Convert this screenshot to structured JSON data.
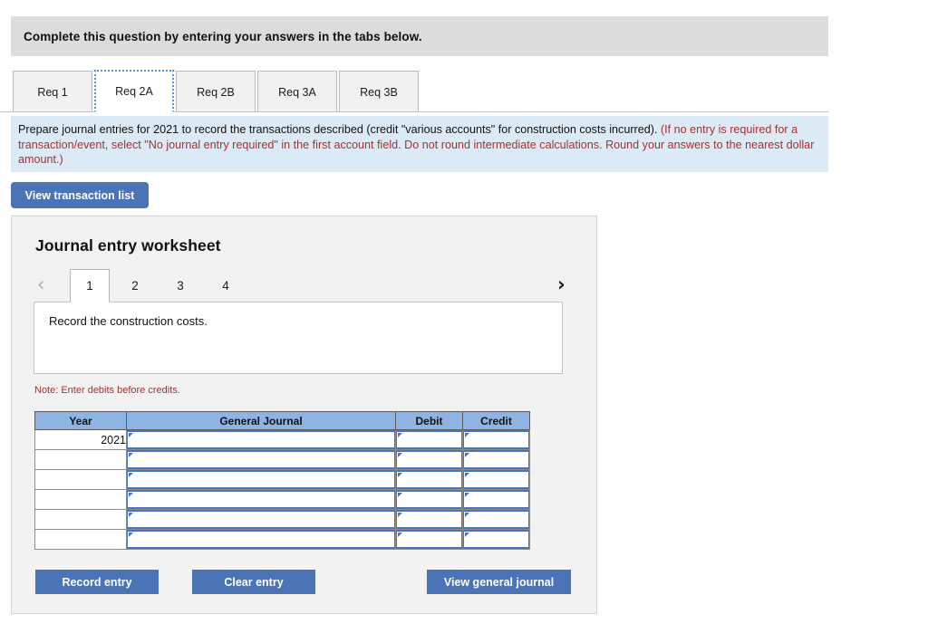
{
  "header": {
    "instruction": "Complete this question by entering your answers in the tabs below."
  },
  "req_tabs": {
    "items": [
      {
        "label": "Req 1",
        "active": false
      },
      {
        "label": "Req 2A",
        "active": true
      },
      {
        "label": "Req 2B",
        "active": false
      },
      {
        "label": "Req 3A",
        "active": false
      },
      {
        "label": "Req 3B",
        "active": false
      }
    ]
  },
  "instructions": {
    "black_text": "Prepare journal entries for 2021 to record the transactions described (credit \"various accounts\" for construction costs incurred). ",
    "red_text": "(If no entry is required for a transaction/event, select \"No journal entry required\" in the first account field. Do not round intermediate calculations. Round your answers to the nearest dollar amount.)"
  },
  "toolbar": {
    "view_transaction_list_label": "View transaction list"
  },
  "worksheet": {
    "title": "Journal entry worksheet",
    "pager": {
      "prev_icon": "‹",
      "next_icon": "›",
      "items": [
        "1",
        "2",
        "3",
        "4"
      ],
      "active_index": 0
    },
    "description": "Record the construction costs.",
    "note": "Note: Enter debits before credits.",
    "table": {
      "columns": [
        "Year",
        "General Journal",
        "Debit",
        "Credit"
      ],
      "rows": [
        {
          "year": "2021",
          "general_journal": "",
          "debit": "",
          "credit": ""
        },
        {
          "year": "",
          "general_journal": "",
          "debit": "",
          "credit": ""
        },
        {
          "year": "",
          "general_journal": "",
          "debit": "",
          "credit": ""
        },
        {
          "year": "",
          "general_journal": "",
          "debit": "",
          "credit": ""
        },
        {
          "year": "",
          "general_journal": "",
          "debit": "",
          "credit": ""
        },
        {
          "year": "",
          "general_journal": "",
          "debit": "",
          "credit": ""
        }
      ]
    },
    "buttons": {
      "record_entry": "Record entry",
      "clear_entry": "Clear entry",
      "view_general_journal": "View general journal"
    }
  },
  "colors": {
    "header_bar": "#dcdcdc",
    "instructions_panel": "#dceaf6",
    "accent_blue": "#4a74b5",
    "table_header_blue": "#8db4e2",
    "warning_red": "#a33232",
    "panel_gray": "#f2f2f2"
  }
}
